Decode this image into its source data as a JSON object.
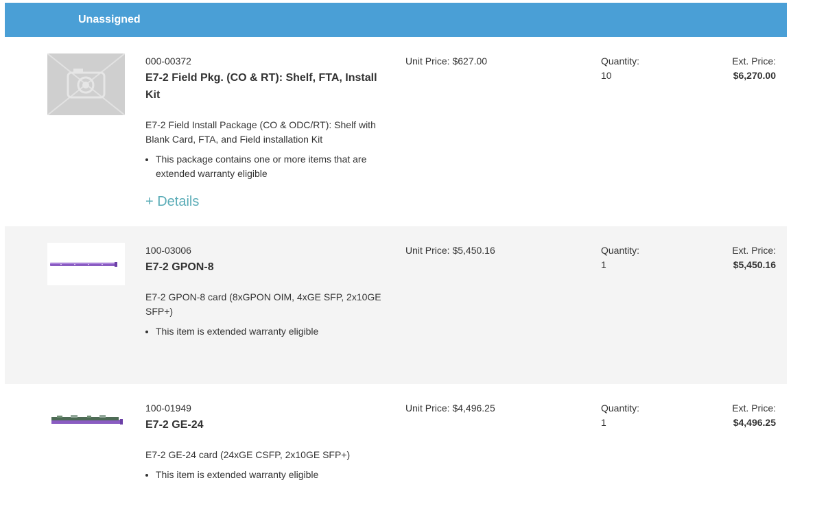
{
  "header": {
    "title": "Unassigned"
  },
  "labels": {
    "unit_price": "Unit Price:",
    "quantity": "Quantity:",
    "ext_price": "Ext. Price:",
    "details": "+ Details"
  },
  "colors": {
    "header_bg": "#4a9fd6",
    "details_link": "#5aacb7",
    "alt_row_bg": "#f4f4f4",
    "card_purple": "#8a5cc2"
  },
  "items": [
    {
      "sku": "000-00372",
      "name": "E7-2 Field Pkg. (CO & RT): Shelf, FTA, Install Kit",
      "description": "E7-2 Field Install Package (CO & ODC/RT): Shelf with Blank Card, FTA, and Field installation Kit",
      "bullet": "This package contains one or more items that are extended warranty eligible",
      "unit_price": "$627.00",
      "quantity": "10",
      "ext_price": "$6,270.00",
      "image_icon": "camera-placeholder-icon"
    },
    {
      "sku": "100-03006",
      "name": "E7-2 GPON-8",
      "description": "E7-2 GPON-8 card (8xGPON OIM, 4xGE SFP, 2x10GE SFP+)",
      "bullet": "This item is extended warranty eligible",
      "unit_price": "$5,450.16",
      "quantity": "1",
      "ext_price": "$5,450.16",
      "image_icon": "gpon-card-image"
    },
    {
      "sku": "100-01949",
      "name": "E7-2 GE-24",
      "description": "E7-2 GE-24 card (24xGE CSFP, 2x10GE SFP+)",
      "bullet": "This item is extended warranty eligible",
      "unit_price": "$4,496.25",
      "quantity": "1",
      "ext_price": "$4,496.25",
      "image_icon": "ge24-card-image"
    }
  ]
}
